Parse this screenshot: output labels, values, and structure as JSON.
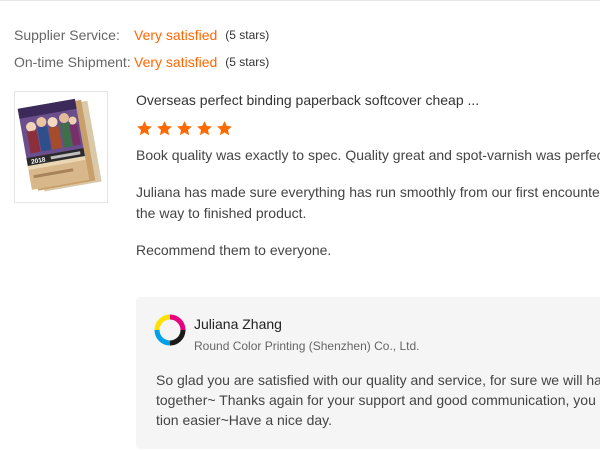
{
  "ratings": [
    {
      "label": "Supplier Service:",
      "value": "Very satisfied",
      "stars_text": "(5 stars)"
    },
    {
      "label": "On-time Shipment:",
      "value": "Very satisfied",
      "stars_text": "(5 stars)"
    }
  ],
  "review": {
    "product_title": "Overseas perfect binding paperback softcover cheap ...",
    "star_rating": 5,
    "star_color": "#ff6a00",
    "paragraphs": [
      [
        "Book quality was exactly to spec. Quality great and spot-varnish was perfect!"
      ],
      [
        "Juliana has made sure everything has run smoothly from our first encounter all",
        "the way to finished product."
      ],
      [
        "Recommend them to everyone."
      ]
    ]
  },
  "thumbnail": {
    "cover_text": "2018"
  },
  "reply": {
    "author": "Juliana Zhang",
    "company": "Round Color Printing (Shenzhen) Co., Ltd.",
    "lines": [
      "So glad you are satisfied with our quality and service,  for sure we will have more",
      "together~ Thanks again for your support and good communication,  you make",
      "tion easier~Have a nice day."
    ]
  },
  "colors": {
    "accent": "#ff6600",
    "reply_background": "#f5f5f5"
  },
  "icons": {
    "star": "star-icon",
    "supplier_logo": "supplier-logo-icon"
  }
}
